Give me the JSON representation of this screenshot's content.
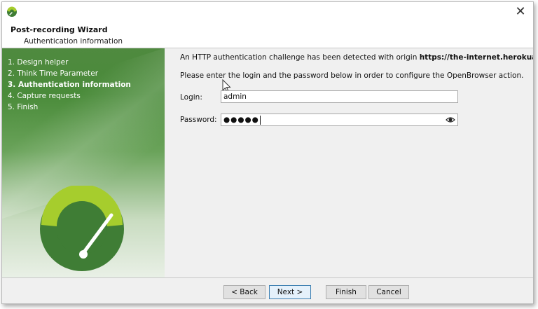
{
  "window": {
    "close_glyph": "✕"
  },
  "header": {
    "title": "Post-recording Wizard",
    "subtitle": "Authentication information"
  },
  "sidebar": {
    "steps": [
      {
        "label": "1. Design helper",
        "active": false
      },
      {
        "label": "2. Think Time Parameter",
        "active": false
      },
      {
        "label": "3. Authentication information",
        "active": true
      },
      {
        "label": "4. Capture requests",
        "active": false
      },
      {
        "label": "5. Finish",
        "active": false
      }
    ]
  },
  "content": {
    "message_prefix": "An HTTP authentication challenge has been detected with origin ",
    "origin": "https://the-internet.herokuapp.com",
    "message_suffix": ".",
    "instruction": "Please enter the login and the password below in order to configure the OpenBrowser action.",
    "login_label": "Login:",
    "login_value": "admin",
    "password_label": "Password:",
    "password_mask": "●●●●●"
  },
  "footer": {
    "back_label": "< Back",
    "next_label": "Next >",
    "finish_label": "Finish",
    "cancel_label": "Cancel"
  },
  "colors": {
    "sidebar_green": "#4a8b3a",
    "logo_lime": "#a6cd2d",
    "logo_green": "#3f7d35"
  }
}
